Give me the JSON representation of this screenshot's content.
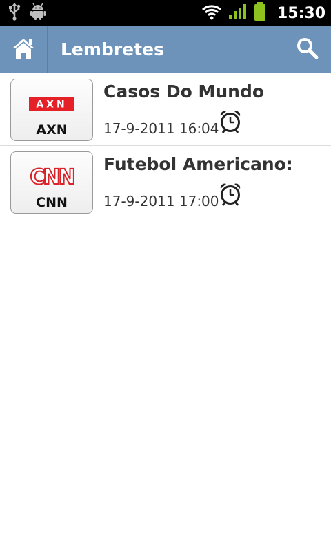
{
  "status_bar": {
    "time": "15:30",
    "icons": [
      "usb-icon",
      "android-debug-icon",
      "wifi-icon",
      "signal-icon",
      "battery-icon"
    ]
  },
  "action_bar": {
    "title": "Lembretes",
    "home_icon": "home-icon",
    "search_icon": "search-icon",
    "background_color": "#6e93ba"
  },
  "reminders": [
    {
      "channel": "AXN",
      "logo_text": "AXN",
      "title": "Casos Do Mundo",
      "datetime": "17-9-2011 16:04",
      "icon": "alarm-clock-icon"
    },
    {
      "channel": "CNN",
      "logo_text": "CNN",
      "title": "Futebol Americano:",
      "datetime": "17-9-2011 17:00",
      "icon": "alarm-clock-icon"
    }
  ]
}
